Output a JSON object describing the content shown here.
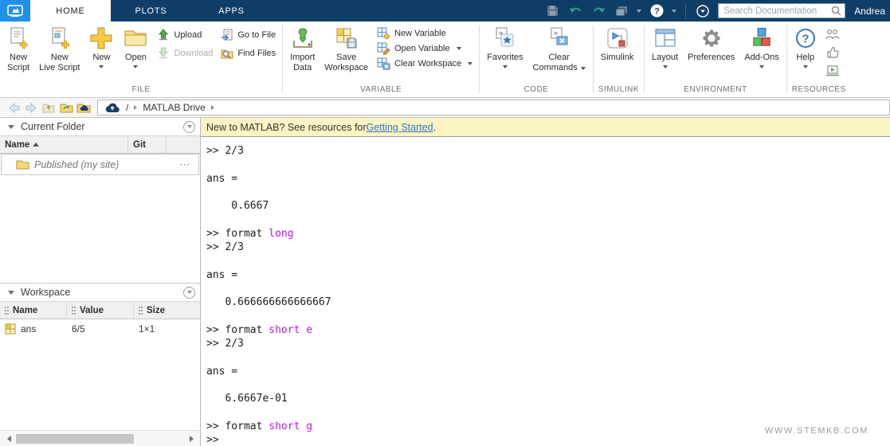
{
  "colors": {
    "topbar": "#0e3e66",
    "logo_tile": "#2090ea",
    "keyword_purple": "#bb16d9",
    "link_blue": "#2e77c0",
    "notice_bg": "#fcf4c3"
  },
  "tabs": [
    {
      "label": "HOME",
      "active": true
    },
    {
      "label": "PLOTS",
      "active": false
    },
    {
      "label": "APPS",
      "active": false
    }
  ],
  "top_right": {
    "search_placeholder": "Search Documentation",
    "user": "Andrea"
  },
  "ribbon": {
    "file": {
      "label": "FILE",
      "new_script1": "New",
      "new_script2": "Script",
      "new_live1": "New",
      "new_live2": "Live Script",
      "new": "New",
      "open": "Open",
      "upload": "Upload",
      "download": "Download",
      "go_to_file": "Go to File",
      "find_files": "Find Files"
    },
    "variable": {
      "label": "VARIABLE",
      "import1": "Import",
      "import2": "Data",
      "savews1": "Save",
      "savews2": "Workspace",
      "new_variable": "New Variable",
      "open_variable": "Open Variable",
      "clear_workspace": "Clear Workspace"
    },
    "code": {
      "label": "CODE",
      "favorites": "Favorites",
      "clear1": "Clear",
      "clear2": "Commands"
    },
    "simulink": {
      "label": "SIMULINK",
      "simulink": "Simulink"
    },
    "environment": {
      "label": "ENVIRONMENT",
      "layout": "Layout",
      "preferences": "Preferences",
      "addons": "Add-Ons"
    },
    "resources": {
      "label": "RESOURCES",
      "help": "Help"
    }
  },
  "breadcrumb": {
    "root": "/",
    "drive": "MATLAB Drive"
  },
  "current_folder": {
    "title": "Current Folder",
    "columns": {
      "name": "Name",
      "git": "Git"
    },
    "row": {
      "name": "Published",
      "suffix": "(my site)",
      "ellipsis": "⋯"
    }
  },
  "workspace": {
    "title": "Workspace",
    "columns": {
      "name": "Name",
      "value": "Value",
      "size": "Size"
    },
    "row": {
      "name": "ans",
      "value": "6/5",
      "size": "1×1"
    }
  },
  "notice": {
    "text": "New to MATLAB? See resources for ",
    "link": "Getting Started",
    "period": "."
  },
  "console": {
    "lines": [
      [
        [
          "t",
          ">> 2/3"
        ]
      ],
      [],
      [
        [
          "t",
          "ans ="
        ]
      ],
      [],
      [
        [
          "t",
          "    0.6667"
        ]
      ],
      [],
      [
        [
          "t",
          ">> format "
        ],
        [
          "k",
          "long"
        ]
      ],
      [
        [
          "t",
          ">> 2/3"
        ]
      ],
      [],
      [
        [
          "t",
          "ans ="
        ]
      ],
      [],
      [
        [
          "t",
          "   0.666666666666667"
        ]
      ],
      [],
      [
        [
          "t",
          ">> format "
        ],
        [
          "k",
          "short e"
        ]
      ],
      [
        [
          "t",
          ">> 2/3"
        ]
      ],
      [],
      [
        [
          "t",
          "ans ="
        ]
      ],
      [],
      [
        [
          "t",
          "   6.6667e-01"
        ]
      ],
      [],
      [
        [
          "t",
          ">> format "
        ],
        [
          "k",
          "short g"
        ]
      ],
      [
        [
          "t",
          ">>"
        ]
      ]
    ]
  },
  "watermark": "WWW.STEMKB.COM",
  "glyphs": {
    "question": "?"
  }
}
